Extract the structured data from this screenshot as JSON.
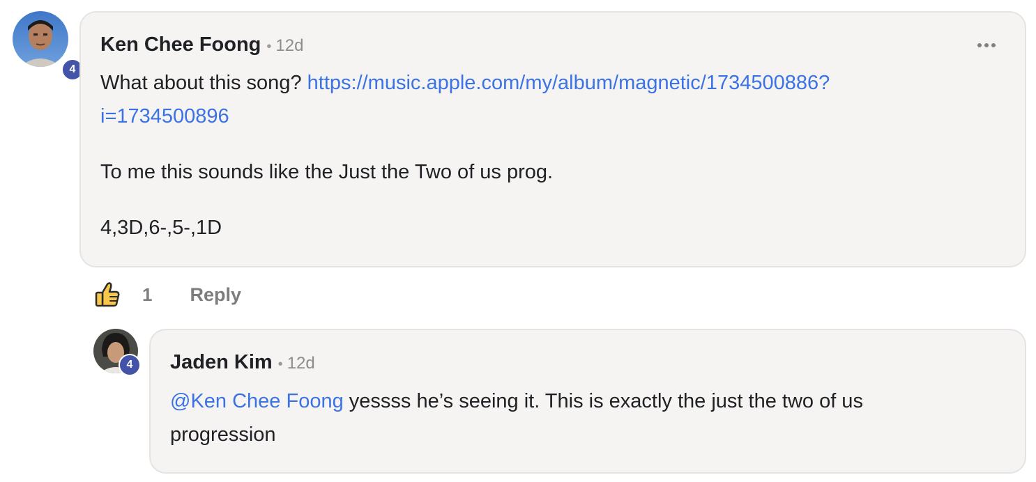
{
  "comment": {
    "author": "Ken Chee Foong",
    "separator": "•",
    "time": "12d",
    "level": "4",
    "text_before_link": "What about this song? ",
    "link_line1": "https://music.apple.com/my/album/magnetic/1734500886?",
    "link_line2": "i=1734500896",
    "paragraph2": "To me this sounds like the Just the Two of us prog.",
    "paragraph3": "4,3D,6-,5-,1D",
    "like_count": "1",
    "reply_label": "Reply",
    "like_icon": "thumbs-up-icon",
    "more_icon": "more-horizontal-icon"
  },
  "reply": {
    "author": "Jaden Kim",
    "separator": "•",
    "time": "12d",
    "level": "4",
    "mention": "@Ken Chee Foong",
    "text_line1": " yessss he’s seeing it. This is exactly the just the two of us",
    "text_line2": "progression"
  },
  "colors": {
    "bubble_bg": "#f5f4f3",
    "link": "#3b73e4",
    "badge": "#4353a8"
  }
}
